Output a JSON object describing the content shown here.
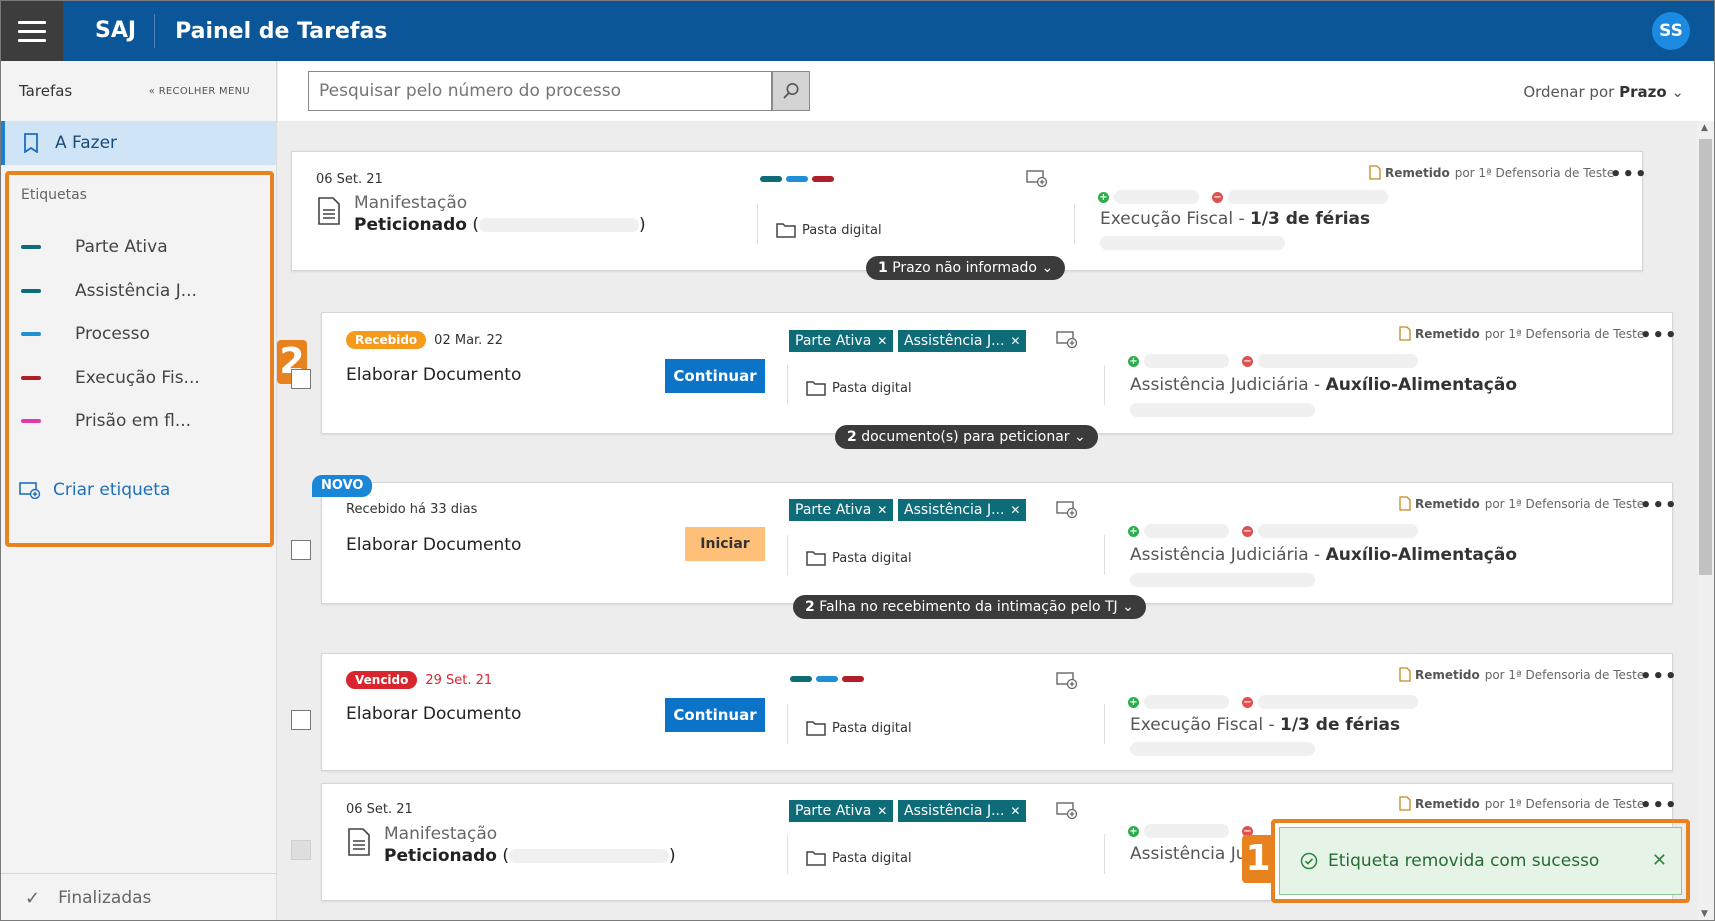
{
  "header": {
    "brand": "SAJ",
    "title": "Painel de Tarefas",
    "avatar": "SS"
  },
  "sidebar": {
    "title": "Tarefas",
    "collapse_label": "RECOLHER MENU",
    "active_item": "A Fazer",
    "section_title": "Etiquetas",
    "tags": [
      {
        "name": "Parte Ativa",
        "color": "#0e6b78"
      },
      {
        "name": "Assistência J...",
        "color": "#0e6b78"
      },
      {
        "name": "Processo",
        "color": "#1f8fd6"
      },
      {
        "name": "Execução Fis...",
        "color": "#b01e2a"
      },
      {
        "name": "Prisão em fl...",
        "color": "#e23aa8"
      }
    ],
    "create_label": "Criar etiqueta",
    "finished_label": "Finalizadas"
  },
  "annotations": {
    "one": "1",
    "two": "2"
  },
  "search": {
    "placeholder": "Pesquisar pelo número do processo"
  },
  "sort": {
    "prefix": "Ordenar por",
    "value": "Prazo"
  },
  "common": {
    "folder": "Pasta digital",
    "remetido": "Remetido",
    "por": "por 1ª Defensoria de Teste",
    "more": "•••",
    "sep": " - "
  },
  "cards": [
    {
      "date": "06 Set. 21",
      "line1": "Manifestação",
      "line2": "Peticionado",
      "line2_paren_open": "(",
      "line2_paren_close": ")",
      "class_a": "Execução Fiscal",
      "class_b": "1/3 de férias",
      "footer": {
        "count": "1",
        "text": "Prazo não informado"
      }
    },
    {
      "status": "Recebido",
      "status_color": "#f59a1a",
      "date": "02 Mar. 22",
      "title": "Elaborar Documento",
      "button": "Continuar",
      "tags": [
        "Parte Ativa",
        "Assistência J..."
      ],
      "class_a": "Assistência Judiciária",
      "class_b": "Auxílio-Alimentação",
      "footer": {
        "count": "2",
        "text": "documento(s) para peticionar"
      }
    },
    {
      "badge": "NOVO",
      "date": "Recebido há 33 dias",
      "title": "Elaborar Documento",
      "button": "Iniciar",
      "tags": [
        "Parte Ativa",
        "Assistência J..."
      ],
      "class_a": "Assistência Judiciária",
      "class_b": "Auxílio-Alimentação",
      "footer": {
        "count": "2",
        "text": "Falha no recebimento da intimação pelo TJ"
      }
    },
    {
      "status": "Vencido",
      "status_color": "#d9262e",
      "date": "29 Set. 21",
      "title": "Elaborar Documento",
      "button": "Continuar",
      "class_a": "Execução Fiscal",
      "class_b": "1/3 de férias"
    },
    {
      "date": "06 Set. 21",
      "line1": "Manifestação",
      "line2": "Peticionado",
      "line2_paren_open": "(",
      "line2_paren_close": ")",
      "tags": [
        "Parte Ativa",
        "Assistência J..."
      ],
      "class_a": "Assistência Juc"
    }
  ],
  "toast": {
    "message": "Etiqueta removida com sucesso",
    "close": "✕"
  }
}
